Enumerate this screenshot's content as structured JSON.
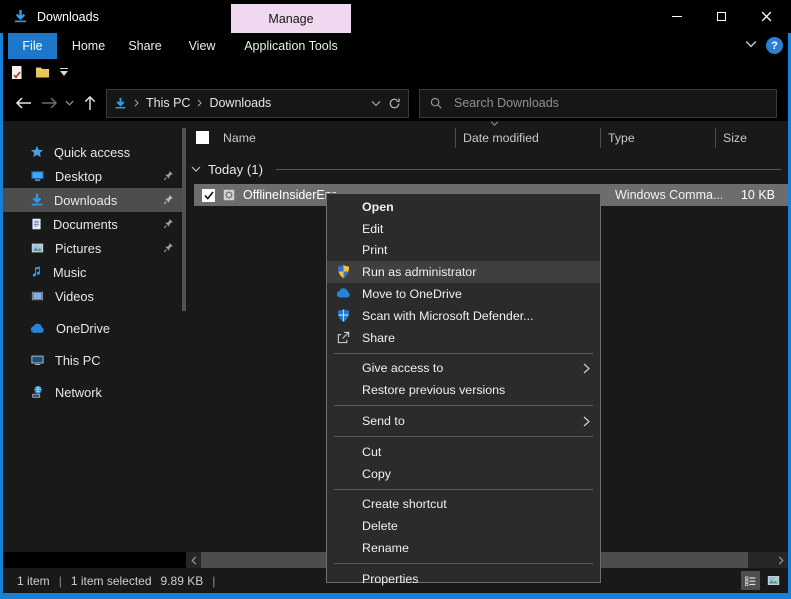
{
  "titlebar": {
    "title": "Downloads",
    "contextual_group": "Manage"
  },
  "ribbon": {
    "tabs": [
      "File",
      "Home",
      "Share",
      "View",
      "Application Tools"
    ],
    "active_tab": "File",
    "help_label": "?"
  },
  "navbar": {
    "breadcrumb": {
      "root": "This PC",
      "current": "Downloads"
    },
    "search_placeholder": "Search Downloads"
  },
  "sidebar": {
    "items": [
      {
        "label": "Quick access"
      },
      {
        "label": "Desktop"
      },
      {
        "label": "Downloads"
      },
      {
        "label": "Documents"
      },
      {
        "label": "Pictures"
      },
      {
        "label": "Music"
      },
      {
        "label": "Videos"
      },
      {
        "label": "OneDrive"
      },
      {
        "label": "This PC"
      },
      {
        "label": "Network"
      }
    ],
    "selected": "Downloads"
  },
  "filelist": {
    "columns": [
      "Name",
      "Date modified",
      "Type",
      "Size"
    ],
    "group_label": "Today (1)",
    "row": {
      "name": "OfflineInsiderEnr",
      "type": "Windows Comma...",
      "size": "10 KB",
      "checked": true,
      "selected": true
    }
  },
  "context_menu": {
    "items": [
      "Open",
      "Edit",
      "Print",
      "Run as administrator",
      "Move to OneDrive",
      "Scan with Microsoft Defender...",
      "Share",
      "Give access to",
      "Restore previous versions",
      "Send to",
      "Cut",
      "Copy",
      "Create shortcut",
      "Delete",
      "Rename",
      "Properties"
    ],
    "highlighted": "Run as administrator"
  },
  "statusbar": {
    "count": "1 item",
    "sep": "|",
    "selected": "1 item selected",
    "size": "9.89 KB"
  },
  "colors": {
    "accent_border": "#1581d8",
    "file_tab_blue": "#1d78c9",
    "manage_tab_pink": "#f0d9f0",
    "row_selection_gray": "#6d6d6d",
    "menu_bg": "#2b2b2b",
    "content_bg": "#191919"
  }
}
